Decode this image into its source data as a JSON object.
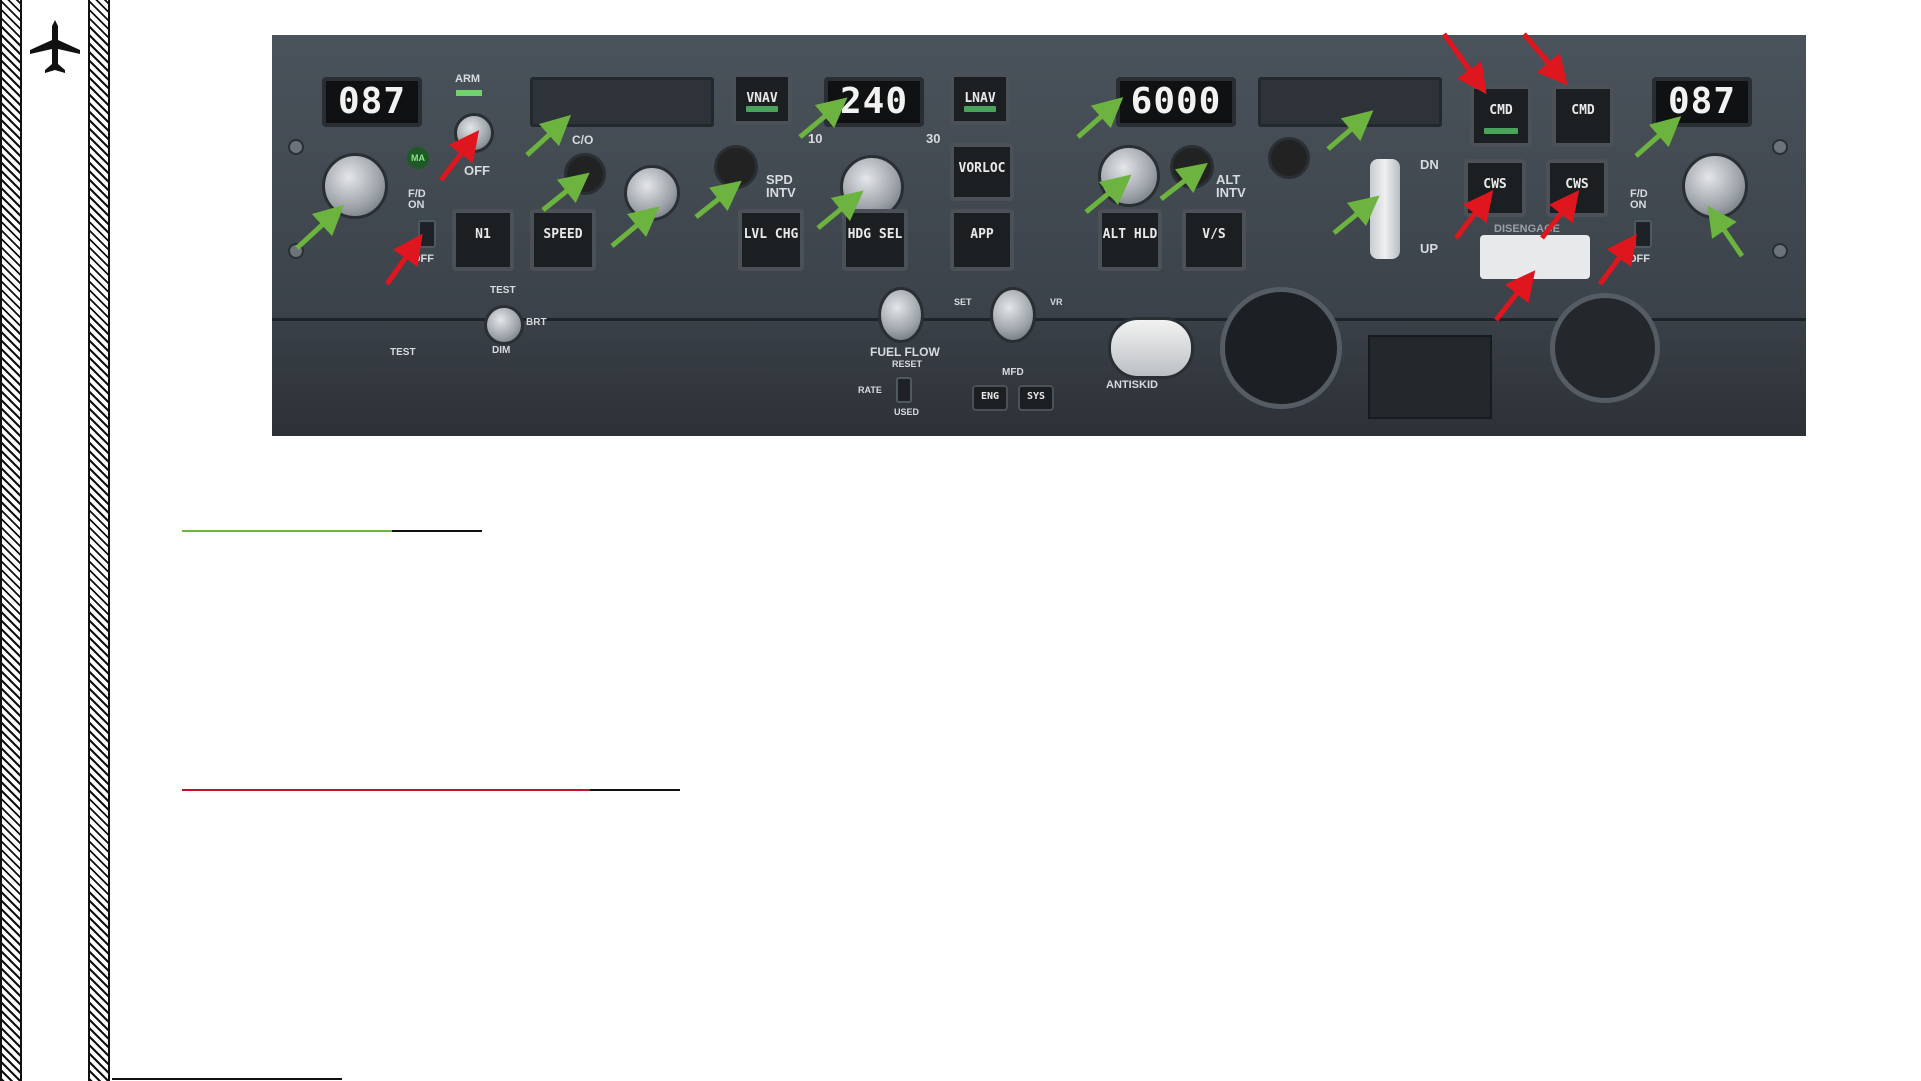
{
  "panel": {
    "left_course": "087",
    "right_course": "087",
    "speed": "240",
    "altitude": "6000",
    "labels": {
      "arm": "ARM",
      "off": "OFF",
      "ma": "MA",
      "fd_on": "F/D ON",
      "fd_off": "OFF",
      "co": "C/O",
      "spd_intv": "SPD INTV",
      "alt_intv": "ALT INTV",
      "dn": "DN",
      "up": "UP",
      "disengage": "DISENGAGE",
      "fuel_flow": "FUEL FLOW",
      "reset": "RESET",
      "rate": "RATE",
      "used": "USED",
      "mfd": "MFD",
      "antiskid": "ANTISKID",
      "test": "TEST",
      "dim": "DIM",
      "brt": "BRT",
      "set": "SET",
      "vr": "VR"
    },
    "buttons": {
      "vnav": "VNAV",
      "lnav": "LNAV",
      "vorloc": "VORLOC",
      "app": "APP",
      "n1": "N1",
      "speed": "SPEED",
      "lvl_chg": "LVL CHG",
      "hdg_sel": "HDG SEL",
      "alt_hld": "ALT HLD",
      "vs": "V/S",
      "cmd_a": "CMD",
      "cmd_b": "CMD",
      "cws_a": "CWS",
      "cws_b": "CWS",
      "eng": "ENG",
      "sys": "SYS"
    },
    "hdg_scale": [
      "10",
      "30"
    ]
  },
  "colors": {
    "green_arrow": "#6db33f",
    "red_arrow": "#e0161e",
    "green_rule": "#6db33f",
    "red_rule": "#c8102e"
  },
  "icons": [
    "airplane-icon"
  ]
}
